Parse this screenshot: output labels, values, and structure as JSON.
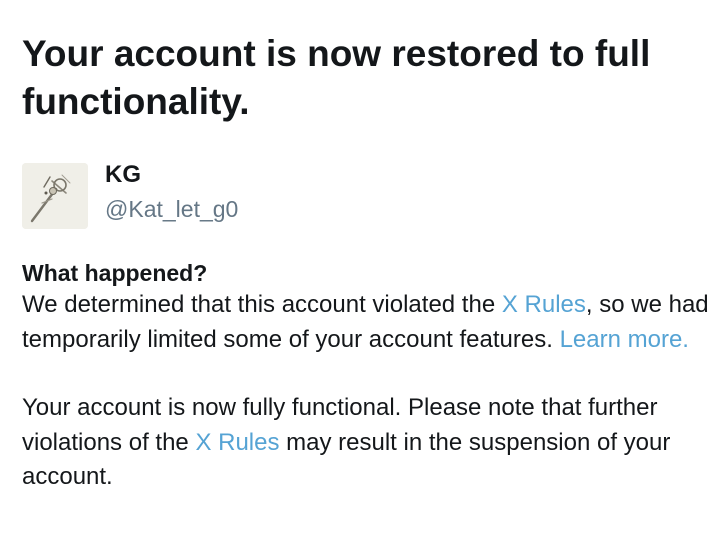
{
  "notice": {
    "title": "Your account is now restored to full functionality."
  },
  "profile": {
    "name": "KG",
    "handle": "@Kat_let_g0",
    "avatar_icon": "avatar-photo"
  },
  "what_happened": {
    "heading": "What happened?",
    "para1_before": "We determined that this account violated the ",
    "para1_link": "X Rules",
    "para1_after": ", so we had temporarily limited some of your account features. ",
    "para1_learn_more": "Learn more.",
    "para2_before": "Your account is now fully functional. Please note that further violations of the ",
    "para2_link": "X Rules",
    "para2_after": " may result in the suspension of your account."
  },
  "colors": {
    "text": "#14171a",
    "secondary": "#657786",
    "link": "#55a3d4"
  }
}
